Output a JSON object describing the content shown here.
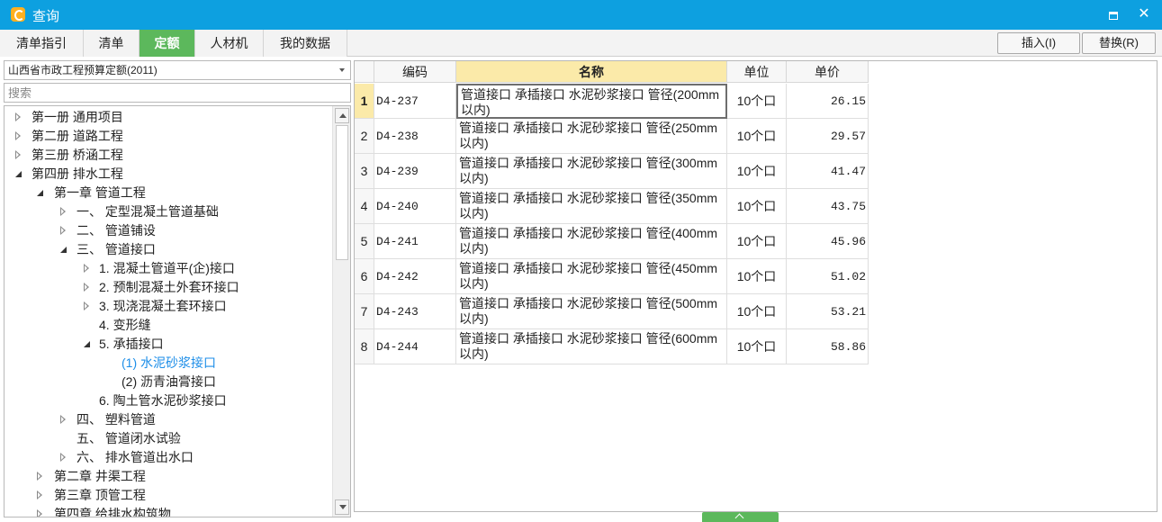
{
  "window": {
    "title": "查询",
    "accent": "#0da0e0"
  },
  "tabs": [
    {
      "label": "清单指引",
      "active": false
    },
    {
      "label": "清单",
      "active": false
    },
    {
      "label": "定额",
      "active": true
    },
    {
      "label": "人材机",
      "active": false
    },
    {
      "label": "我的数据",
      "active": false
    }
  ],
  "actions": {
    "insert_label": "插入(I)",
    "replace_label": "替换(R)"
  },
  "left": {
    "dropdown_value": "山西省市政工程预算定额(2011)",
    "search_placeholder": "搜索",
    "tree": [
      {
        "label": "第一册  通用项目",
        "level": 0,
        "state": "collapsed"
      },
      {
        "label": "第二册  道路工程",
        "level": 0,
        "state": "collapsed"
      },
      {
        "label": "第三册  桥涵工程",
        "level": 0,
        "state": "collapsed"
      },
      {
        "label": "第四册  排水工程",
        "level": 0,
        "state": "expanded"
      },
      {
        "label": "第一章  管道工程",
        "level": 1,
        "state": "expanded"
      },
      {
        "label": "一、   定型混凝土管道基础",
        "level": 2,
        "state": "collapsed"
      },
      {
        "label": "二、   管道铺设",
        "level": 2,
        "state": "collapsed"
      },
      {
        "label": "三、   管道接口",
        "level": 2,
        "state": "expanded"
      },
      {
        "label": "1.  混凝土管道平(企)接口",
        "level": 3,
        "state": "collapsed"
      },
      {
        "label": "2.  预制混凝土外套环接口",
        "level": 3,
        "state": "collapsed"
      },
      {
        "label": "3.  现浇混凝土套环接口",
        "level": 3,
        "state": "collapsed"
      },
      {
        "label": "4.  变形缝",
        "level": 3,
        "state": "leaf"
      },
      {
        "label": "5.  承插接口",
        "level": 3,
        "state": "expanded"
      },
      {
        "label": "(1) 水泥砂浆接口",
        "level": 4,
        "state": "leaf",
        "selected": true
      },
      {
        "label": "(2) 沥青油膏接口",
        "level": 4,
        "state": "leaf"
      },
      {
        "label": "6.  陶土管水泥砂浆接口",
        "level": 3,
        "state": "leaf"
      },
      {
        "label": "四、   塑料管道",
        "level": 2,
        "state": "collapsed"
      },
      {
        "label": "五、   管道闭水试验",
        "level": 2,
        "state": "leaf"
      },
      {
        "label": "六、   排水管道出水口",
        "level": 2,
        "state": "collapsed"
      },
      {
        "label": "第二章  井渠工程",
        "level": 1,
        "state": "collapsed"
      },
      {
        "label": "第三章  顶管工程",
        "level": 1,
        "state": "collapsed"
      },
      {
        "label": "第四章  给排水构筑物",
        "level": 1,
        "state": "collapsed"
      }
    ]
  },
  "grid": {
    "headers": [
      "",
      "编码",
      "名称",
      "单位",
      "单价"
    ],
    "rows": [
      {
        "idx": "1",
        "code": "D4-237",
        "name": "管道接口 承插接口 水泥砂浆接口 管径(200mm以内)",
        "unit": "10个口",
        "price": "26.15"
      },
      {
        "idx": "2",
        "code": "D4-238",
        "name": "管道接口 承插接口 水泥砂浆接口 管径(250mm以内)",
        "unit": "10个口",
        "price": "29.57"
      },
      {
        "idx": "3",
        "code": "D4-239",
        "name": "管道接口 承插接口 水泥砂浆接口 管径(300mm以内)",
        "unit": "10个口",
        "price": "41.47"
      },
      {
        "idx": "4",
        "code": "D4-240",
        "name": "管道接口 承插接口 水泥砂浆接口 管径(350mm以内)",
        "unit": "10个口",
        "price": "43.75"
      },
      {
        "idx": "5",
        "code": "D4-241",
        "name": "管道接口 承插接口 水泥砂浆接口 管径(400mm以内)",
        "unit": "10个口",
        "price": "45.96"
      },
      {
        "idx": "6",
        "code": "D4-242",
        "name": "管道接口 承插接口 水泥砂浆接口 管径(450mm以内)",
        "unit": "10个口",
        "price": "51.02"
      },
      {
        "idx": "7",
        "code": "D4-243",
        "name": "管道接口 承插接口 水泥砂浆接口 管径(500mm以内)",
        "unit": "10个口",
        "price": "53.21"
      },
      {
        "idx": "8",
        "code": "D4-244",
        "name": "管道接口 承插接口 水泥砂浆接口 管径(600mm以内)",
        "unit": "10个口",
        "price": "58.86"
      }
    ]
  }
}
